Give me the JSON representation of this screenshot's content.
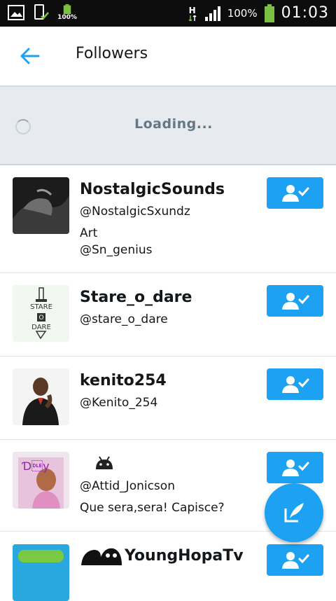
{
  "status_bar": {
    "battery_small": "100%",
    "network": "H",
    "battery": "100%",
    "time": "01:03"
  },
  "header": {
    "title": "Followers"
  },
  "loading": {
    "text": "Loading..."
  },
  "followers": [
    {
      "name": "NostalgicSounds",
      "handle": "@NostalgicSxundz",
      "bio_lines": [
        "Art",
        "@Sn_genius"
      ]
    },
    {
      "name": "Stare_o_dare",
      "handle": "@stare_o_dare",
      "bio_lines": []
    },
    {
      "name": "kenito254",
      "handle": "@Kenito_254",
      "bio_lines": []
    },
    {
      "name": "",
      "handle": "@Attid_Jonicson",
      "bio_lines": [
        "Que sera,sera! Capisce?"
      ]
    },
    {
      "name": "YoungHopaTv",
      "handle": "",
      "bio_lines": []
    }
  ],
  "avatar_text": {
    "stare_top": "STARE",
    "stare_mid": "O",
    "stare_bottom": "DARE",
    "attid_mark": "Ɗ\u0010y"
  },
  "colors": {
    "accent": "#1da1f2",
    "status_bar": "#0d0d0d",
    "loading_bg": "#e7ebef",
    "battery_green": "#7bc043"
  }
}
